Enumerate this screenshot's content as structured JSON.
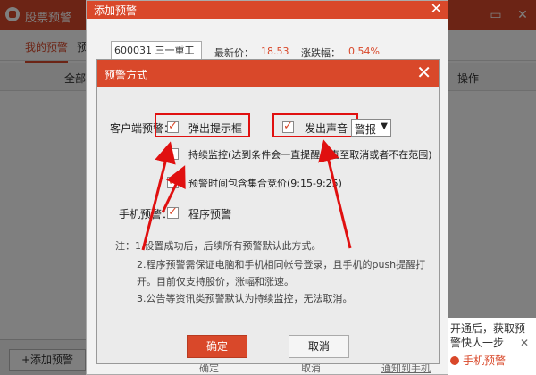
{
  "main_window": {
    "title": "股票预警",
    "tabs": [
      "我的预警",
      "预"
    ],
    "columns": [
      "全部",
      "操作"
    ],
    "add_button": "+添加预警"
  },
  "toast": {
    "text_line1": "开通后，获取预",
    "text_line2": "警快人一步",
    "brand": "手机预警"
  },
  "add_dialog": {
    "title": "添加预警",
    "stock_input": "600031 三一重工",
    "latest_price_label": "最新价：",
    "latest_price": "18.53",
    "change_label": "涨跌幅：",
    "change": "0.54%",
    "ghost_ok": "确定",
    "ghost_cancel": "取消",
    "ghost_link": "通知到手机"
  },
  "dialog": {
    "title": "预警方式",
    "client_label": "客户端预警：",
    "popup_label": "弹出提示框",
    "sound_label": "发出声音",
    "sound_select": "警报",
    "continuous_label": "持续监控(达到条件会一直提醒，直至取消或者不在范围)",
    "auction_label": "预警时间包含集合竞价(9:15-9:25)",
    "mobile_label": "手机预警：",
    "program_label": "程序预警",
    "notes": [
      "注：1.设置成功后，后续所有预警默认此方式。",
      "2.程序预警需保证电脑和手机相同帐号登录，且手机的push提醒打",
      "开。目前仅支持股价，涨幅和涨速。",
      "3.公告等资讯类预警默认为持续监控，无法取消。"
    ],
    "ok_label": "确定",
    "cancel_label": "取消",
    "checked": {
      "popup": true,
      "sound": true,
      "continuous": false,
      "auction": true,
      "program": true
    }
  },
  "colors": {
    "brand_red": "#d9482a",
    "annotation_red": "#e01010"
  }
}
